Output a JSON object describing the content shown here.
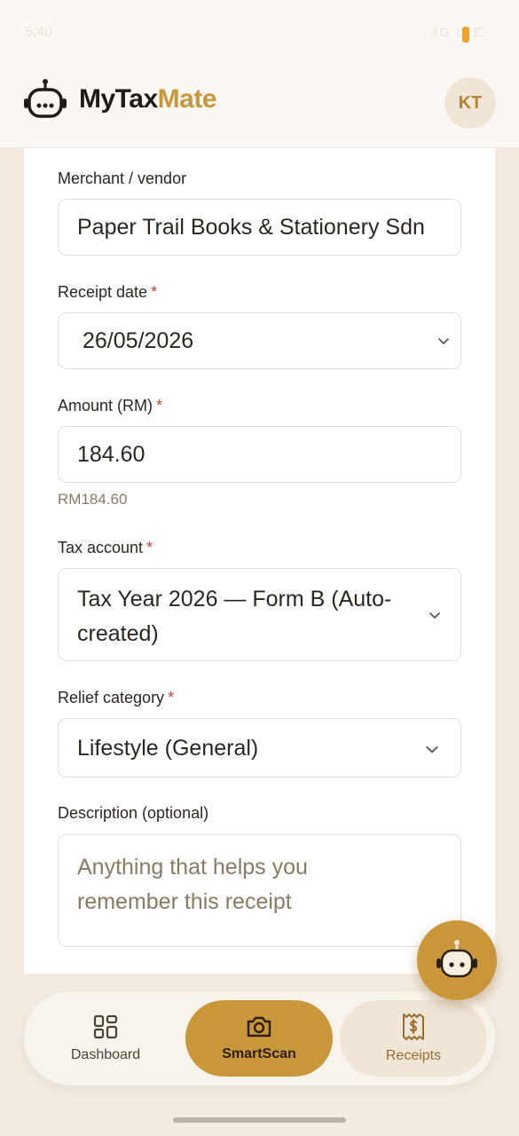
{
  "status": {
    "time": "5:40",
    "icons": "4G LTE"
  },
  "app": {
    "name_part1": "MyTax",
    "name_part2": "Mate"
  },
  "user": {
    "initials": "KT"
  },
  "form": {
    "merchant_label": "Merchant / vendor",
    "merchant_value": "Paper Trail Books & Stationery Sdn",
    "date_label": "Receipt date",
    "date_value": "26/05/2026",
    "amount_label": "Amount (RM)",
    "amount_value": "184.60",
    "amount_helper": "RM184.60",
    "tax_label": "Tax account",
    "tax_value": "Tax Year 2026 — Form B (Auto-created)",
    "relief_label": "Relief category",
    "relief_value": "Lifestyle (General)",
    "desc_label": "Description (optional)",
    "desc_placeholder": "Anything that helps you remember this receipt",
    "required_mark": "*"
  },
  "nav": {
    "items": [
      {
        "label": "Dashboard",
        "icon": "dashboard-grid-icon"
      },
      {
        "label": "SmartScan",
        "icon": "camera-icon"
      },
      {
        "label": "Receipts",
        "icon": "receipt-dollar-icon"
      }
    ]
  },
  "colors": {
    "accent": "#c9973a",
    "background": "#f4ece0",
    "required": "#d0433a"
  }
}
